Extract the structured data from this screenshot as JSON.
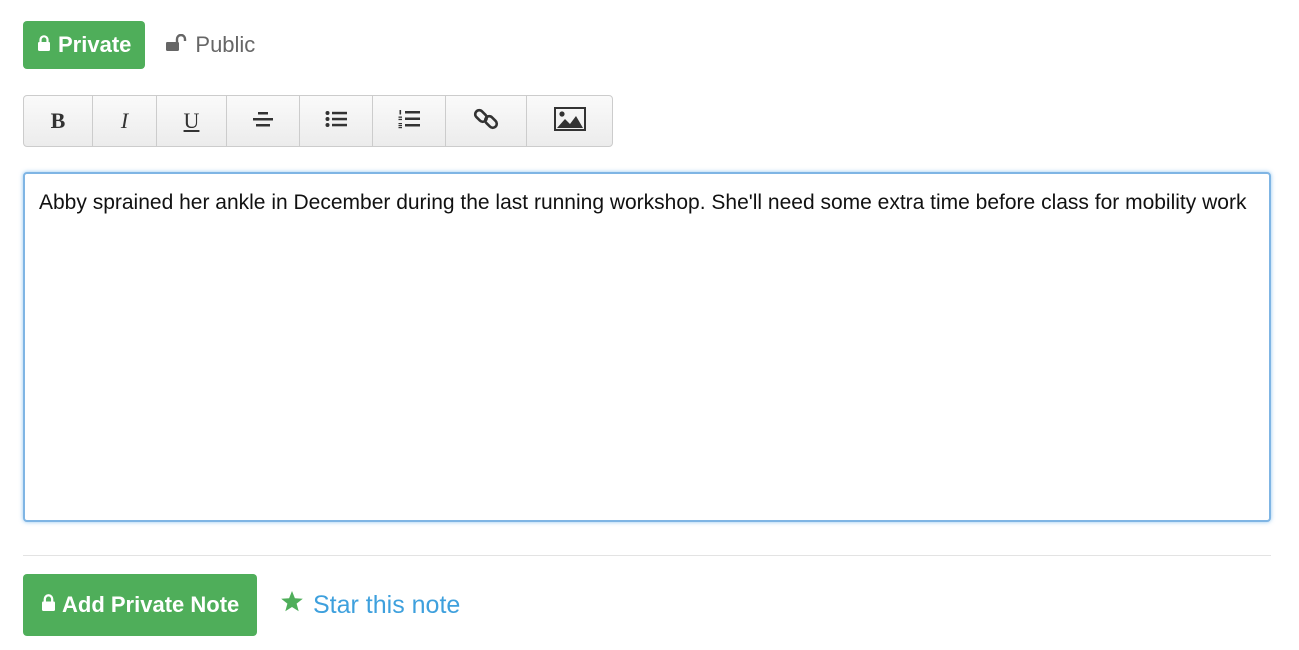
{
  "visibility": {
    "private_label": "Private",
    "public_label": "Public",
    "selected": "Private"
  },
  "toolbar": {
    "buttons": [
      {
        "name": "bold",
        "glyph": "B"
      },
      {
        "name": "italic",
        "glyph": "I"
      },
      {
        "name": "underline",
        "glyph": "U"
      },
      {
        "name": "strikethrough",
        "icon": "strikethrough-icon"
      },
      {
        "name": "bullet-list",
        "icon": "bullet-list-icon"
      },
      {
        "name": "numbered-list",
        "icon": "numbered-list-icon"
      },
      {
        "name": "link",
        "icon": "link-icon"
      },
      {
        "name": "image",
        "icon": "image-icon"
      }
    ]
  },
  "editor": {
    "content": "Abby sprained her ankle in December during the last running workshop. She'll need some extra time before class for mobility work"
  },
  "actions": {
    "add_note_label": "Add Private Note",
    "star_label": "Star this note"
  },
  "colors": {
    "primary_green": "#4fae5a",
    "link_blue": "#3ea0dd",
    "star_green": "#4fae5a",
    "focus_border": "#7fb5e4"
  }
}
